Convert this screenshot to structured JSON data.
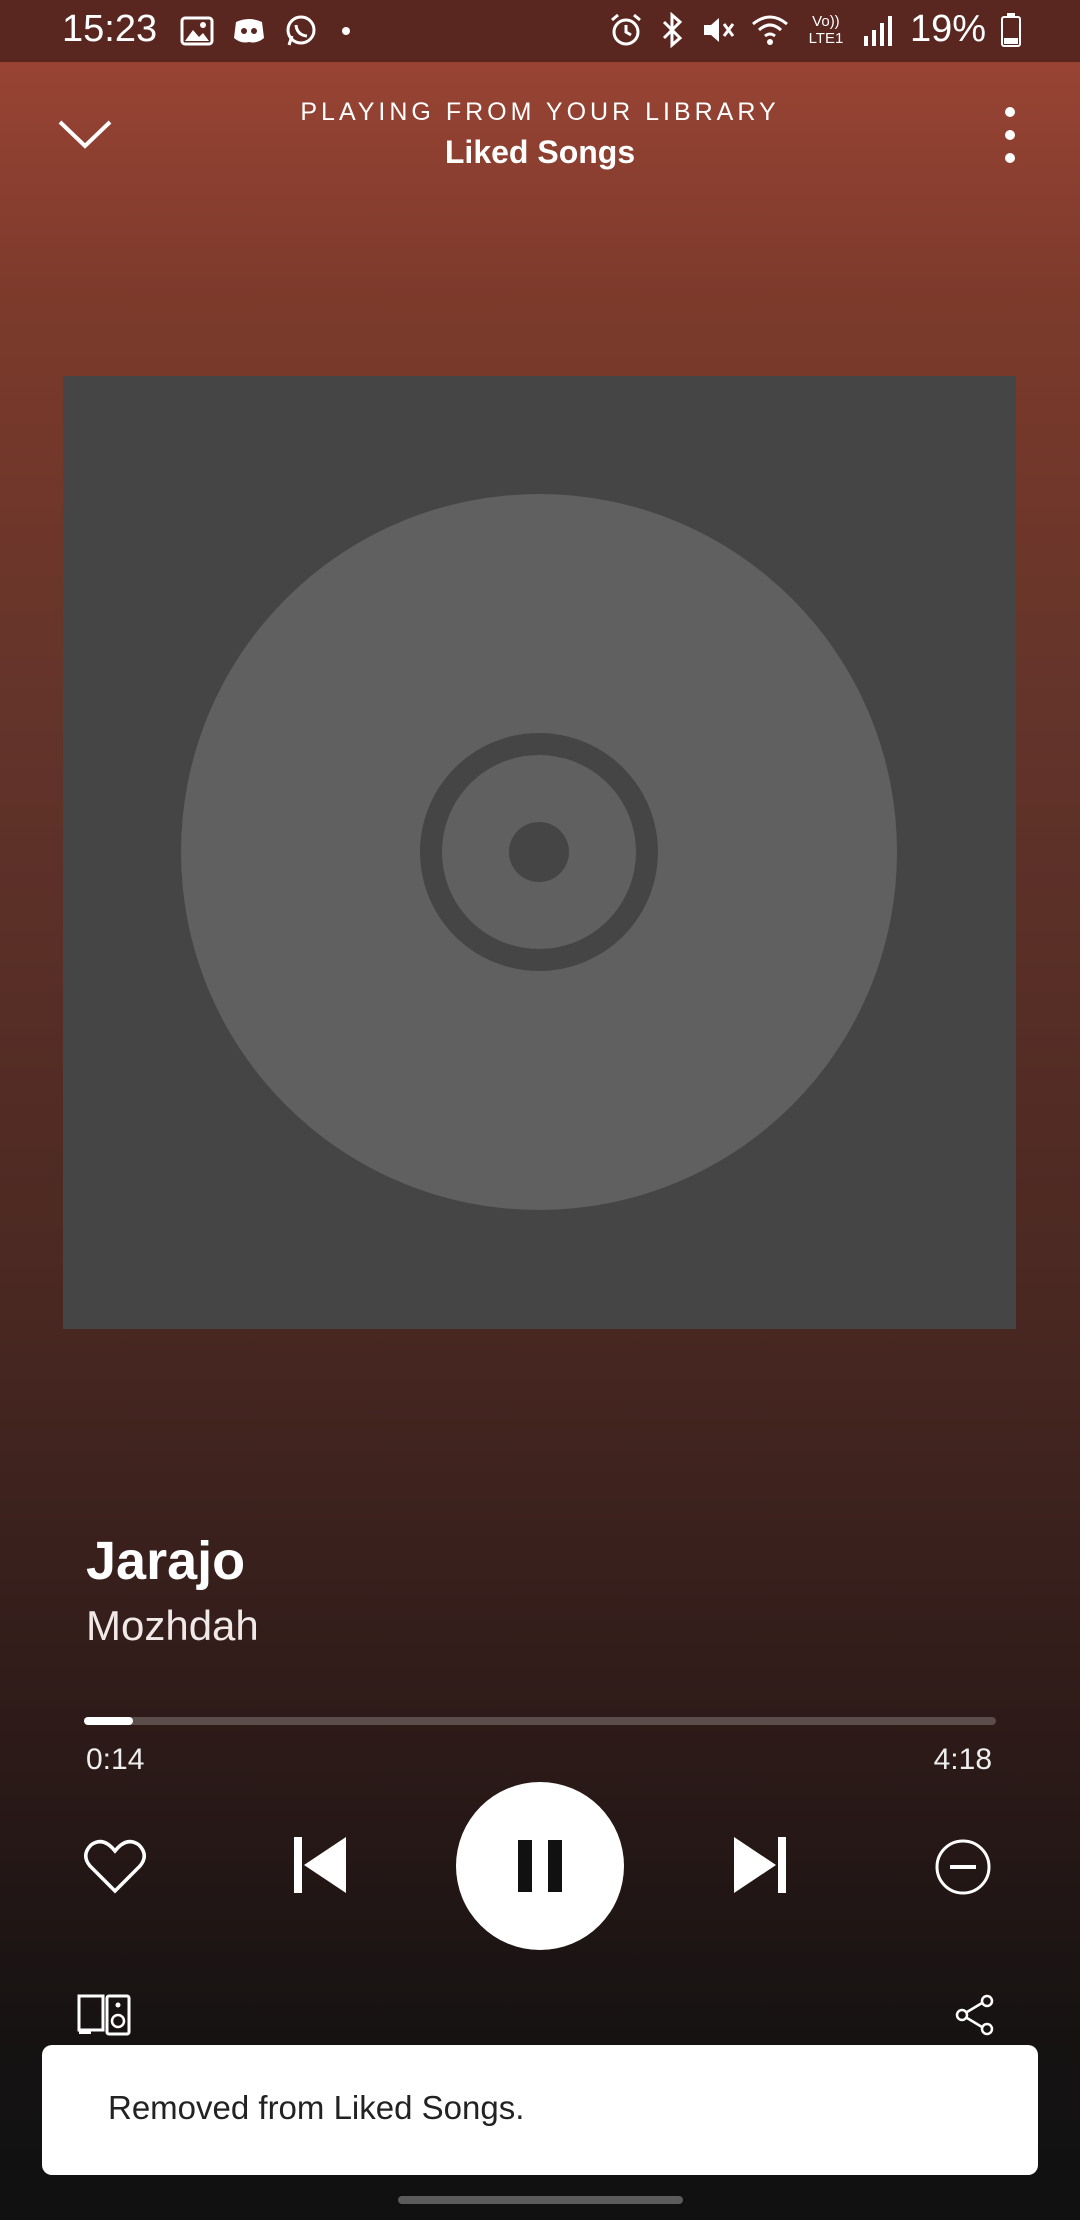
{
  "status_bar": {
    "time": "15:23",
    "battery": "19%",
    "signal_text": "Vo)) LTE1",
    "left_icons": [
      "gallery-icon",
      "discord-icon",
      "whatsapp-icon",
      "dot-icon"
    ],
    "right_icons": [
      "alarm-icon",
      "bluetooth-icon",
      "mute-icon",
      "wifi-icon",
      "signal-icon",
      "battery-icon"
    ]
  },
  "header": {
    "context": "PLAYING FROM YOUR LIBRARY",
    "title": "Liked Songs"
  },
  "track": {
    "title": "Jarajo",
    "artist": "Mozhdah"
  },
  "playback": {
    "elapsed": "0:14",
    "total": "4:18",
    "progress": 0.054,
    "state": "playing"
  },
  "snackbar": {
    "message": "Removed from Liked Songs."
  },
  "colors": {
    "accent_bg_top": "#a04636",
    "accent_bg_bottom": "#111111",
    "album_placeholder": "#454545",
    "disc": "#606060"
  }
}
